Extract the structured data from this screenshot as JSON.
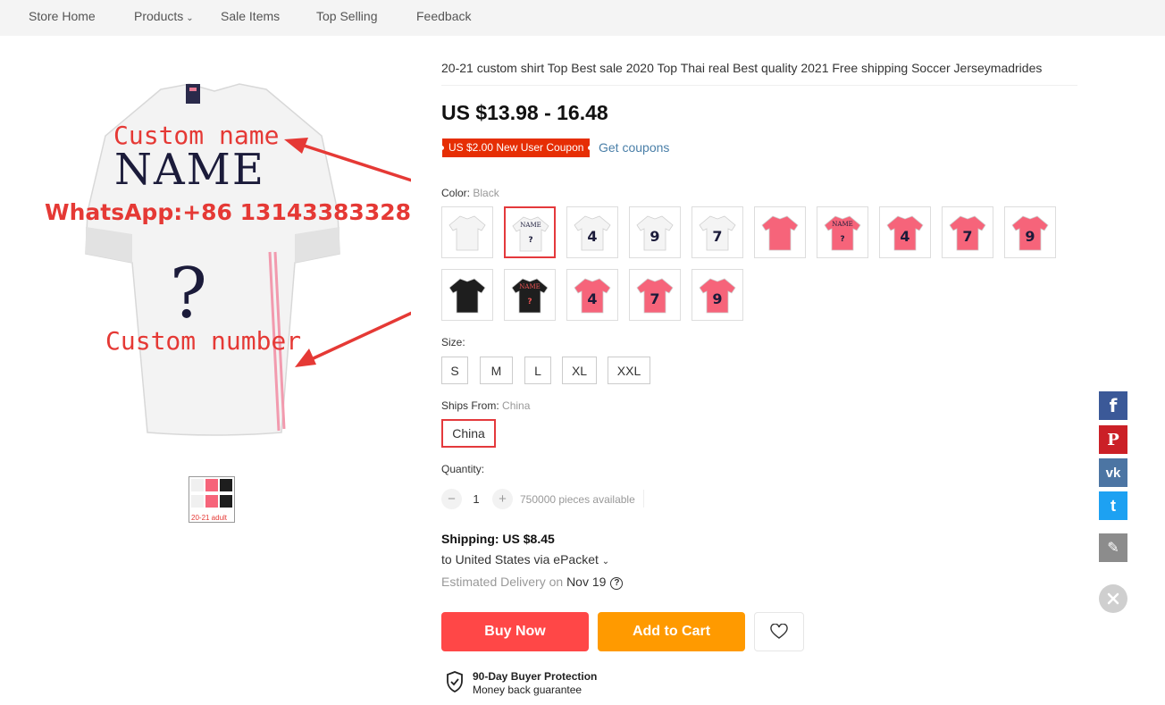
{
  "nav": {
    "items": [
      {
        "label": "Store Home"
      },
      {
        "label": "Products"
      },
      {
        "label": "Sale Items"
      },
      {
        "label": "Top Selling"
      },
      {
        "label": "Feedback"
      }
    ]
  },
  "gallery": {
    "overlay_custom_name": "Custom name",
    "overlay_name": "NAME",
    "overlay_whatsapp": "WhatsApp:+86 13143383328",
    "overlay_question": "?",
    "overlay_custom_number": "Custom number",
    "thumb_caption": "20-21 adult"
  },
  "product": {
    "title": "20-21 custom shirt Top Best sale 2020 Top Thai real Best quality 2021 Free shipping Soccer Jerseymadrides",
    "price": "US $13.98 - 16.48",
    "coupon": "US $2.00 New User Coupon",
    "get_coupons": "Get coupons",
    "color_label": "Color:",
    "color_value": "Black",
    "colors": [
      {
        "shirt": "#f4f4f4",
        "name_text": "",
        "num": ""
      },
      {
        "shirt": "#f4f4f4",
        "name_text": "NAME",
        "num": "?"
      },
      {
        "shirt": "#f4f4f4",
        "name_text": "",
        "num": "4"
      },
      {
        "shirt": "#f4f4f4",
        "name_text": "",
        "num": "9"
      },
      {
        "shirt": "#f4f4f4",
        "name_text": "",
        "num": "7"
      },
      {
        "shirt": "#f6647a",
        "name_text": "",
        "num": ""
      },
      {
        "shirt": "#f6647a",
        "name_text": "NAME",
        "num": "?"
      },
      {
        "shirt": "#f6647a",
        "name_text": "",
        "num": "4"
      },
      {
        "shirt": "#f6647a",
        "name_text": "",
        "num": "7"
      },
      {
        "shirt": "#f6647a",
        "name_text": "",
        "num": "9"
      },
      {
        "shirt": "#1e1e1e",
        "name_text": "",
        "num": ""
      },
      {
        "shirt": "#1e1e1e",
        "name_text": "NAME",
        "num": "?"
      },
      {
        "shirt": "#f6647a",
        "name_text": "",
        "num": "4"
      },
      {
        "shirt": "#f6647a",
        "name_text": "",
        "num": "7"
      },
      {
        "shirt": "#f6647a",
        "name_text": "",
        "num": "9"
      }
    ],
    "selected_color_index": 1,
    "size_label": "Size:",
    "sizes": [
      "S",
      "M",
      "L",
      "XL",
      "XXL"
    ],
    "ships_from_label": "Ships From:",
    "ships_from_value": "China",
    "ships_option": "China",
    "quantity_label": "Quantity:",
    "quantity": "1",
    "minus": "−",
    "plus": "+",
    "available": "750000 pieces available",
    "shipping": "Shipping: US $8.45",
    "ship_to": "to United States via ePacket",
    "delivery_prefix": "Estimated Delivery on",
    "delivery_date": "Nov 19",
    "buy_now": "Buy Now",
    "add_to_cart": "Add to Cart",
    "protection_title": "90-Day Buyer Protection",
    "protection_sub": "Money back guarantee"
  },
  "share": {
    "facebook": {
      "glyph": "f",
      "color": "#3b5998"
    },
    "pinterest": {
      "glyph": "P",
      "color": "#cb2027"
    },
    "vk": {
      "glyph": "vk",
      "color": "#4c75a3"
    },
    "twitter": {
      "glyph": "t",
      "color": "#1da1f2"
    },
    "edit": {
      "glyph": "✎",
      "color": "#8c8c8c"
    }
  }
}
